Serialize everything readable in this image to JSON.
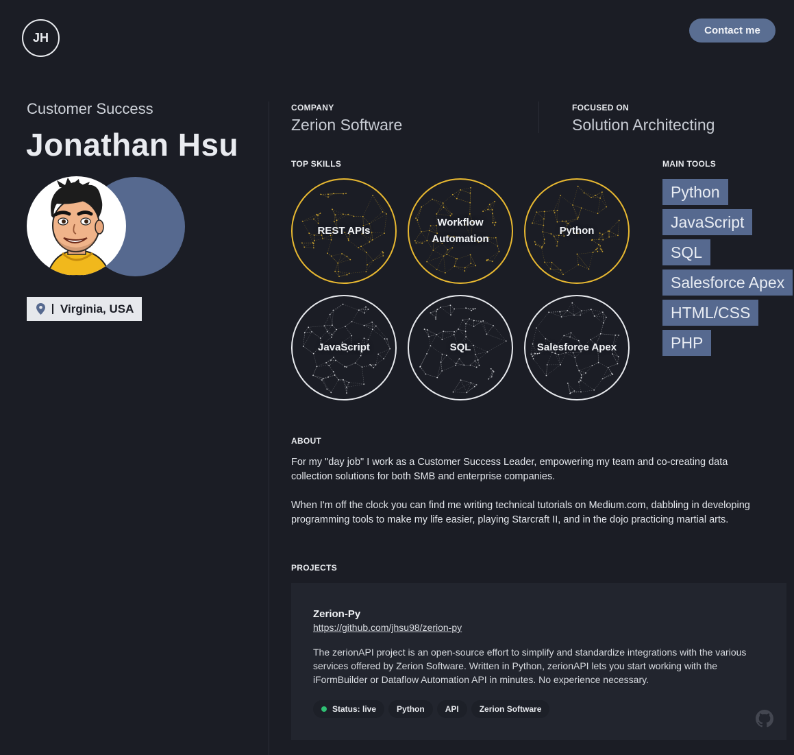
{
  "header": {
    "logo_initials": "JH",
    "contact_label": "Contact me"
  },
  "profile": {
    "role": "Customer Success",
    "name": "Jonathan Hsu",
    "location": "Virginia, USA",
    "location_icon": "map-pin-icon",
    "avatar_colors": {
      "accent": "#56698f"
    }
  },
  "info": {
    "company_label": "COMPANY",
    "company_value": "Zerion Software",
    "focus_label": "FOCUSED ON",
    "focus_value": "Solution Architecting"
  },
  "skills": {
    "label": "TOP SKILLS",
    "items": [
      {
        "line1": "REST APIs",
        "line2": "",
        "highlight": true
      },
      {
        "line1": "Workflow",
        "line2": "Automation",
        "highlight": true
      },
      {
        "line1": "Python",
        "line2": "",
        "highlight": true
      },
      {
        "line1": "JavaScript",
        "line2": "",
        "highlight": false
      },
      {
        "line1": "SQL",
        "line2": "",
        "highlight": false
      },
      {
        "line1": "Salesforce Apex",
        "line2": "",
        "highlight": false
      }
    ],
    "colors": {
      "highlight": "#e9b931",
      "normal": "#e8eaee"
    }
  },
  "tools": {
    "label": "MAIN TOOLS",
    "items": [
      "Python",
      "JavaScript",
      "SQL",
      "Salesforce Apex",
      "HTML/CSS",
      "PHP"
    ]
  },
  "about": {
    "label": "ABOUT",
    "p1": "For my \"day job\" I work as a Customer Success Leader, empowering my team and co-creating data collection solutions for both SMB and enterprise companies.",
    "p2": "When I'm off the clock you can find me writing technical tutorials on Medium.com, dabbling in developing programming tools to make my life easier, playing Starcraft II, and in the dojo practicing martial arts."
  },
  "projects": {
    "label": "PROJECTS",
    "items": [
      {
        "title": "Zerion-Py",
        "link": "https://github.com/jhsu98/zerion-py",
        "description": "The zerionAPI project is an open-source effort to simplify and standardize integrations with the various services offered by Zerion Software. Written in Python, zerionAPI lets you start working with the iFormBuilder or Dataflow Automation API in minutes. No experience necessary.",
        "tags": [
          "Status: live",
          "Python",
          "API",
          "Zerion Software"
        ],
        "status_color": "#2fbf73",
        "icon": "github-icon"
      }
    ]
  }
}
